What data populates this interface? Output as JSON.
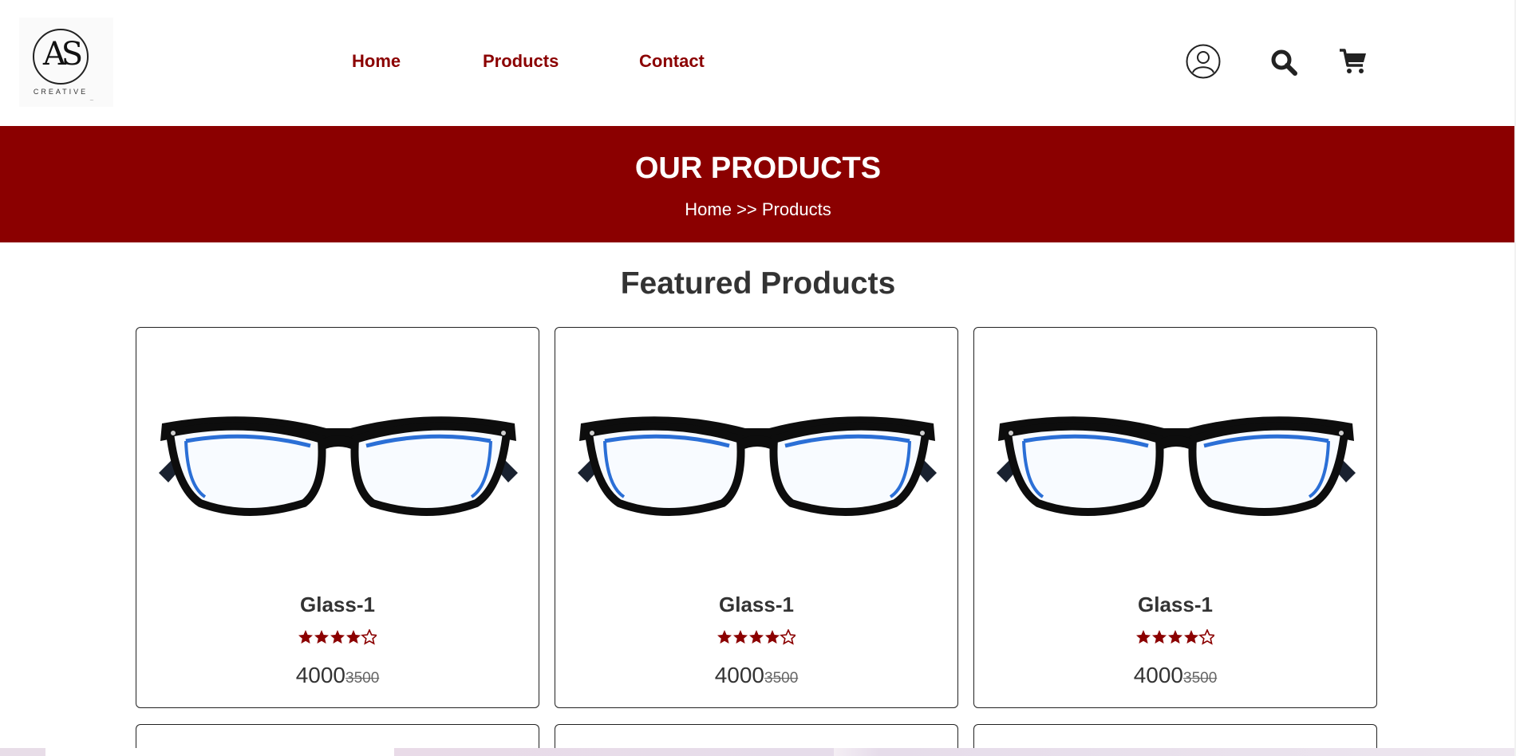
{
  "header": {
    "logo": {
      "monogram": "AS",
      "subtitle": "CREATIVE",
      "signature": "signature"
    },
    "nav": [
      {
        "label": "Home"
      },
      {
        "label": "Products"
      },
      {
        "label": "Contact"
      }
    ],
    "icons": [
      "user-icon",
      "search-icon",
      "cart-icon"
    ]
  },
  "banner": {
    "title": "OUR PRODUCTS",
    "breadcrumb": "Home >> Products"
  },
  "featured": {
    "title": "Featured Products",
    "products": [
      {
        "name": "Glass-1",
        "rating": 4.5,
        "price": "4000",
        "old_price": "3500"
      },
      {
        "name": "Glass-1",
        "rating": 4.5,
        "price": "4000",
        "old_price": "3500"
      },
      {
        "name": "Glass-1",
        "rating": 4.5,
        "price": "4000",
        "old_price": "3500"
      }
    ]
  },
  "colors": {
    "brand": "#8b0000",
    "text": "#333333"
  }
}
